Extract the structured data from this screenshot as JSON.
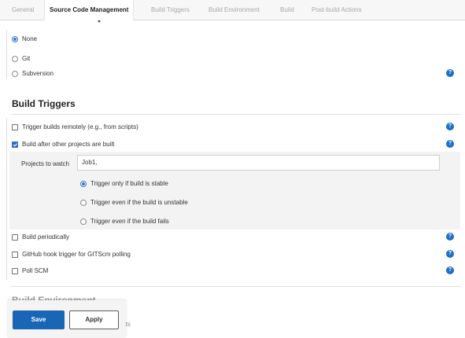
{
  "tabs": [
    {
      "label": "General"
    },
    {
      "label": "Source Code Management"
    },
    {
      "label": "Build Triggers"
    },
    {
      "label": "Build Environment"
    },
    {
      "label": "Build"
    },
    {
      "label": "Post-build Actions"
    }
  ],
  "scm": {
    "options": [
      {
        "label": "None",
        "selected": true
      },
      {
        "label": "Git",
        "selected": false
      },
      {
        "label": "Subversion",
        "selected": false
      }
    ]
  },
  "build_triggers": {
    "title": "Build Triggers",
    "trigger_remotely": {
      "label": "Trigger builds remotely (e.g., from scripts)",
      "checked": false
    },
    "build_after": {
      "label": "Build after other projects are built",
      "checked": true
    },
    "projects_to_watch": {
      "label": "Projects to watch",
      "value": "Job1,"
    },
    "stability": [
      {
        "label": "Trigger only if build is stable",
        "selected": true
      },
      {
        "label": "Trigger even if the build is unstable",
        "selected": false
      },
      {
        "label": "Trigger even if the build fails",
        "selected": false
      }
    ],
    "build_periodically": {
      "label": "Build periodically",
      "checked": false
    },
    "github_hook": {
      "label": "GitHub hook trigger for GITScm polling",
      "checked": false
    },
    "poll_scm": {
      "label": "Poll SCM",
      "checked": false
    }
  },
  "build_environment": {
    "title": "Build Environment",
    "partial_text": "rts"
  },
  "actions": {
    "save": "Save",
    "apply": "Apply"
  },
  "help_glyph": "?",
  "colors": {
    "accent": "#1b6fc7",
    "save_button": "#1866b5"
  }
}
